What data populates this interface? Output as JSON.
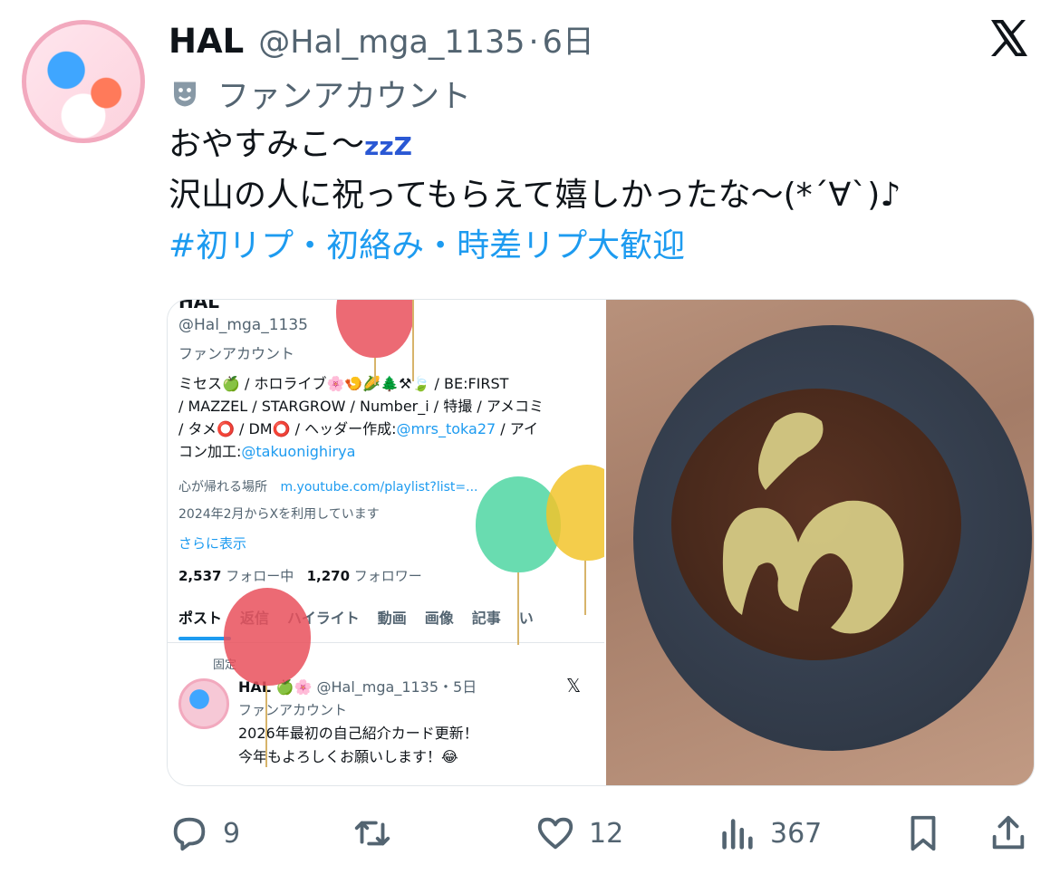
{
  "post": {
    "author_name": "HAL",
    "handle": "@Hal_mga_1135",
    "separator": "·",
    "time": "6日",
    "badge_label": "ファンアカウント",
    "text_line1": "おやすみこ〜",
    "text_zzz": "zzZ",
    "text_line2": "沢山の人に祝ってもらえて嬉しかったな〜(*´∀`)♪",
    "hashtag": "#初リプ・初絡み・時差リプ大歓迎"
  },
  "screenshot": {
    "top_name": "HAL",
    "handle": "@Hal_mga_1135",
    "fan_label": "ファンアカウント",
    "bio_line1": "ミセス🍏 / ホロライブ🌸🍤🌽🌲⚒🍃 / BE:FIRST",
    "bio_line2": "/ MAZZEL / STARGROW / Number_i / 特撮 / アメコミ",
    "bio_line3_pre": "/ タメ⭕ / DM⭕ / ヘッダー作成:",
    "bio_link1": "@mrs_toka27",
    "bio_line3_post": " / アイ",
    "bio_line4_pre": "コン加工:",
    "bio_link2": "@takuonighirya",
    "location": "心が帰れる場所",
    "url": "m.youtube.com/playlist?list=...",
    "joined": "2024年2月からXを利用しています",
    "show_more": "さらに表示",
    "following_count": "2,537",
    "following_label": "フォロー中",
    "followers_count": "1,270",
    "followers_label": "フォロワー",
    "tabs": [
      "ポスト",
      "返信",
      "ハイライト",
      "動画",
      "画像",
      "記事",
      "い"
    ],
    "pinned": "固定",
    "pinned_name": "HAL 🍏🌸",
    "pinned_handle_time": "@Hal_mga_1135・5日",
    "pinned_fan": "ファンアカウント",
    "pinned_text1": "2026年最初の自己紹介カード更新！",
    "pinned_text2": "今年もよろしくお願いします！😂"
  },
  "actions": {
    "replies": "9",
    "reposts": "",
    "likes": "12",
    "views": "367"
  },
  "colors": {
    "link": "#1d9bf0",
    "muted": "#536471",
    "avatar_ring": "#f2a9be"
  }
}
